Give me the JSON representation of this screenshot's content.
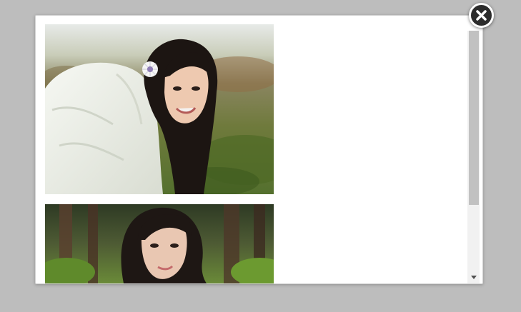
{
  "lightbox": {
    "close_icon": "close-icon",
    "images": [
      {
        "subject": "portrait-girl-white-jacket"
      },
      {
        "subject": "portrait-girl-forest"
      }
    ],
    "scroll_position": 0.0
  },
  "colors": {
    "backdrop": "#bdbdbd",
    "modal": "#ffffff",
    "close_button": "#2c2c2c",
    "scroll_thumb": "#c1c1c1"
  }
}
